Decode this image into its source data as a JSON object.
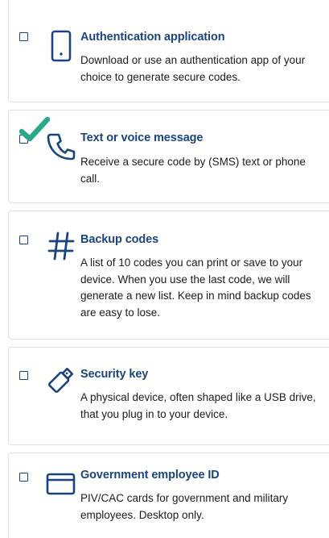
{
  "options": [
    {
      "title": "Authentication application",
      "description": "Download or use an authentication app of your choice to generate secure codes.",
      "icon": "phone-icon",
      "checked": false
    },
    {
      "title": "Text or voice message",
      "description": "Receive a secure code by (SMS) text or phone call.",
      "icon": "phone-handset-icon",
      "checked": true
    },
    {
      "title": "Backup codes",
      "description": "A list of 10 codes you can print or save to your device. When you use the last code, we will generate a new list. Keep in mind backup codes are easy to lose.",
      "icon": "hash-icon",
      "checked": false
    },
    {
      "title": "Security key",
      "description": "A physical device, often shaped like a USB drive, that you plug in to your device.",
      "icon": "security-key-icon",
      "checked": false
    },
    {
      "title": "Government employee ID",
      "description": "PIV/CAC cards for government and military employees. Desktop only.",
      "icon": "id-card-icon",
      "checked": false
    }
  ],
  "colors": {
    "accent": "#1a4480",
    "check": "#2aa88a",
    "border": "#dfe1e2"
  }
}
